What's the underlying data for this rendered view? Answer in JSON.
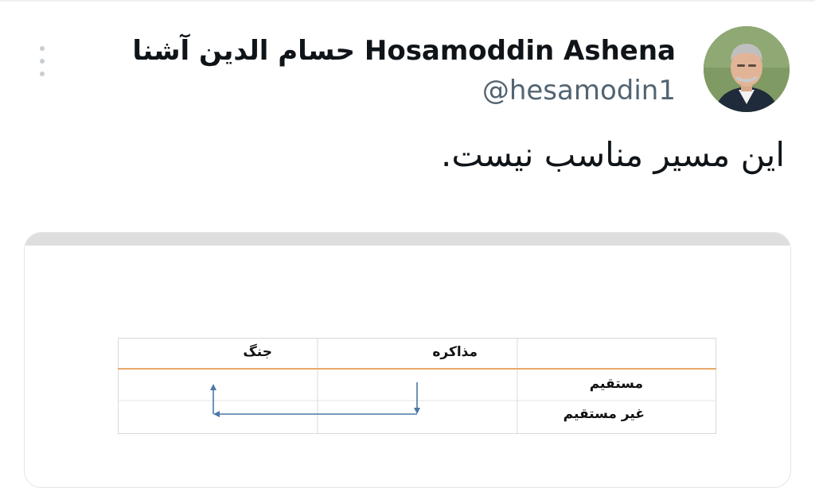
{
  "tweet": {
    "display_name": "حسام الدین آشنا Hosamoddin Ashena",
    "handle": "@hesamodin1",
    "text": "این مسیر مناسب نیست."
  },
  "icons": {
    "more": "more-vertical-icon",
    "avatar": "profile-avatar"
  },
  "media": {
    "table": {
      "header": [
        "",
        "مذاکره",
        "جنگ"
      ],
      "rows": [
        {
          "label": "مستقیم"
        },
        {
          "label": "غیر مستقیم"
        }
      ]
    }
  },
  "colors": {
    "text_primary": "#0f1419",
    "text_secondary": "#536471",
    "header_rule": "#e9a96a",
    "arrow": "#4a78a8"
  }
}
